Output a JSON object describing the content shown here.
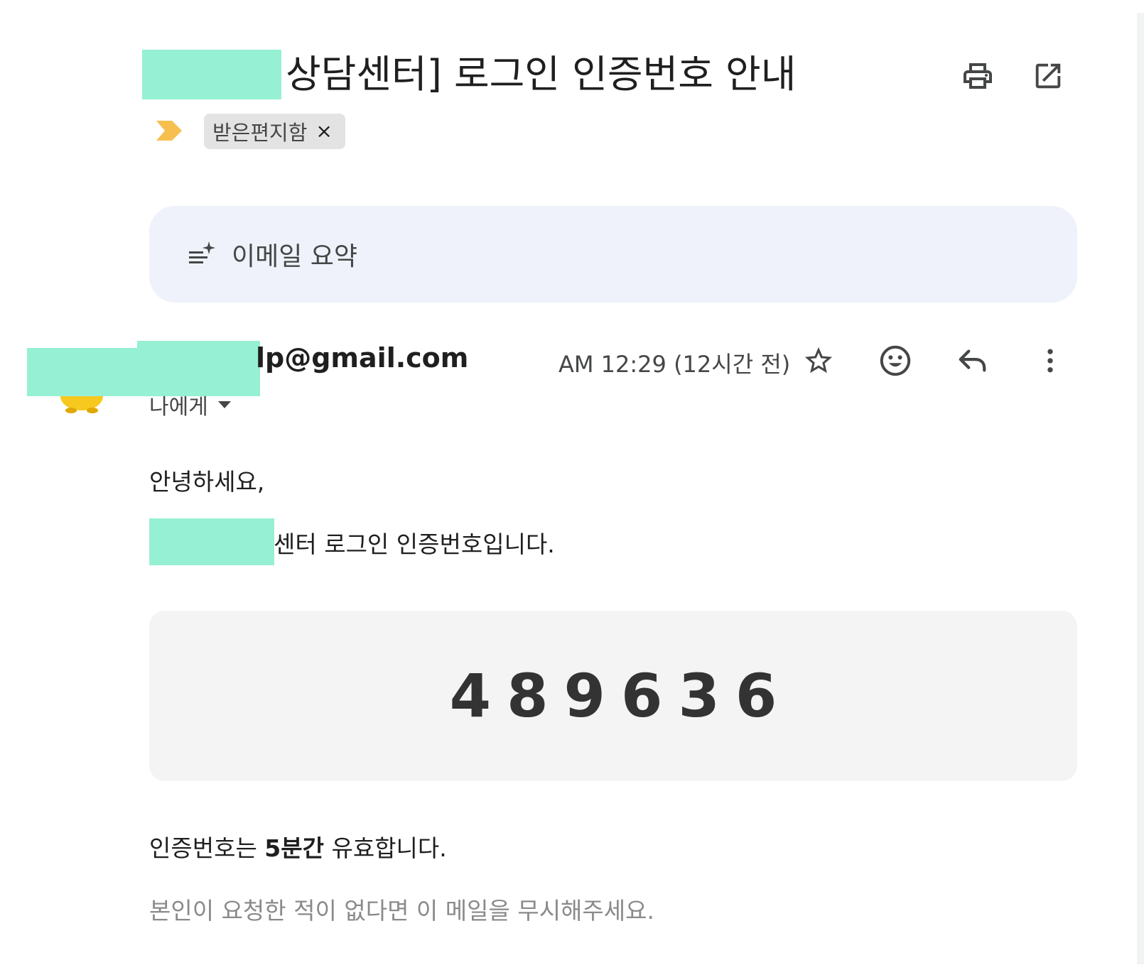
{
  "subject": {
    "title": "상담센터] 로그인 인증번호 안내"
  },
  "toolbar": {
    "print_icon": "print-icon",
    "open_new_window_icon": "open-in-new-window-icon"
  },
  "labels": {
    "importance_marker": "importance-marker-icon",
    "chip_label": "받은편지함",
    "chip_remove": "×"
  },
  "summary": {
    "label": "이메일 요약",
    "icon": "summary-sparkle-icon"
  },
  "message": {
    "sender_visible": "lp@gmail.com",
    "timestamp": "AM 12:29 (12시간 전)",
    "recipient": "나에게",
    "actions": [
      "star-icon",
      "emoji-reaction-icon",
      "reply-icon",
      "more-vert-icon"
    ]
  },
  "body": {
    "greeting": "안녕하세요,",
    "intro_visible": "센터 로그인 인증번호입니다.",
    "code": "489636",
    "validity_prefix": "인증번호는 ",
    "validity_bold": "5분간",
    "validity_suffix": " 유효합니다.",
    "ignore_notice": "본인이 요청한 적이 없다면 이 메일을 무시해주세요."
  },
  "colors": {
    "redaction": "#96f0d4",
    "summary_bg": "#eff2fa",
    "code_bg": "#f4f4f4",
    "importance": "#f6bf4f",
    "chip_bg": "#e3e3e3"
  }
}
